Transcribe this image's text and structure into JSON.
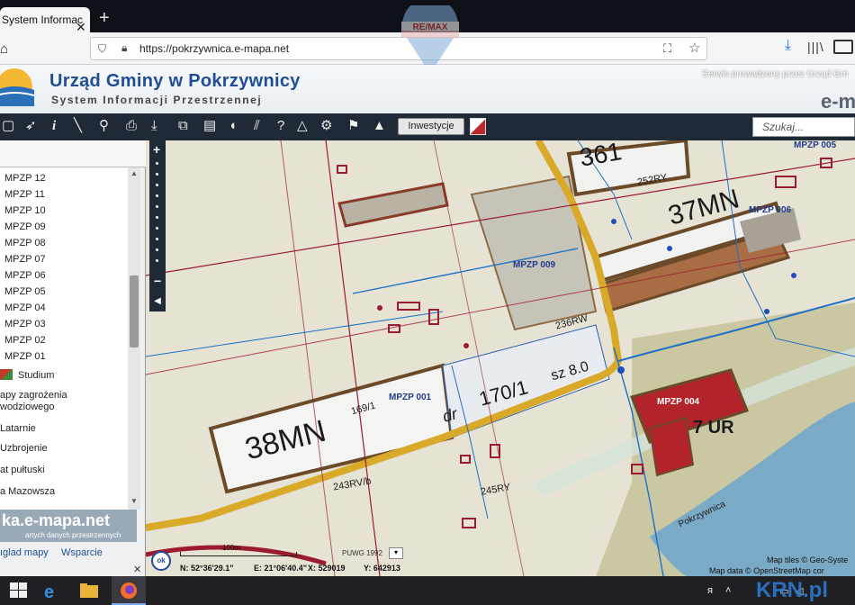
{
  "browser": {
    "tab_title": "System Informac",
    "close_glyph": "✕",
    "newtab_glyph": "+",
    "url": "https://pokrzywnica.e-mapa.net"
  },
  "watermark": {
    "brand": "RE/MAX"
  },
  "header": {
    "title": "Urząd Gminy w Pokrzywnicy",
    "subtitle": "System Informacji Przestrzennej",
    "service_text": "Serwis prowadzony przez Urząd Gm",
    "brand": "e-m"
  },
  "toolbar": {
    "investments_label": "Inwestycje",
    "search_placeholder": "Szukaj..."
  },
  "panel": {
    "layers": [
      "MPZP 12",
      "MPZP 11",
      "MPZP 10",
      "MPZP 09",
      "MPZP 08",
      "MPZP 07",
      "MPZP 06",
      "MPZP 05",
      "MPZP 04",
      "MPZP 03",
      "MPZP 02",
      "MPZP 01"
    ],
    "studium": "Studium",
    "flood_l1": "apy zagrożenia",
    "flood_l2": "wodziowego",
    "lamps": "Latarnie",
    "utilities": "Uzbrojenie",
    "hail": "at pułtuski",
    "mazowsze": "a Mazowsza",
    "ad_url": "ka.e-mapa.net",
    "ad_caption": "artych danych przestrzennych",
    "link_maps": "ıglad mapy",
    "link_support": "Wsparcie",
    "close_glyph": "✕"
  },
  "map": {
    "labels": {
      "mpzp_009": "MPZP 009",
      "mpzp_001": "MPZP 001",
      "mpzp_004": "MPZP 004",
      "mpzp_005": "MPZP 005",
      "mpzp_006": "MPZP 006",
      "zone_38mn": "38MN",
      "zone_37mn": "37MN",
      "zone_7ur": "7 UR",
      "zone_361": "361",
      "parcel_170": "170/1",
      "parcel_169": "169/1",
      "parcel_243": "243RV/b",
      "parcel_245": "245RY",
      "parcel_236": "236RW",
      "parcel_252": "252RY",
      "dr": "dr",
      "sz": "sz 8.0",
      "river": "Pokrzywnica"
    },
    "zoom_plus": "+",
    "zoom_minus": "−"
  },
  "status": {
    "ok": "ok",
    "scale": "100m",
    "coords_n": "N: 52°36'29.1\"",
    "coords_e": "E: 21°06'40.4\"",
    "coords_x": "X: 529019",
    "coords_y": "Y: 642913",
    "projection": "PUWG 1992",
    "tiles_attr": "Map tiles © Geo-Syste",
    "data_attr": "Map data © OpenStreetMap cor"
  },
  "taskbar": {
    "watermark": "KRN.pl"
  },
  "colors": {
    "toolbar_bg": "#1f2a36",
    "header_title": "#1f4e96",
    "road": "#d9a92a",
    "parcel_line": "#9b1b30",
    "utility_line": "#1f6fc4"
  }
}
